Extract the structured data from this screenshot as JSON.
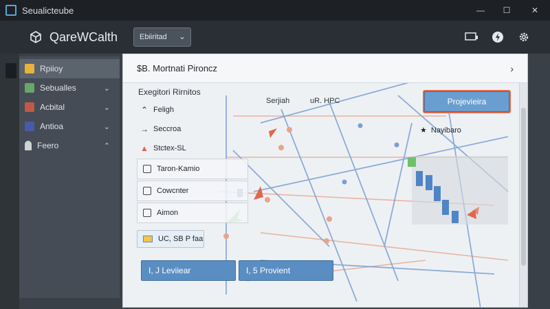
{
  "window": {
    "title": "Seualicteube",
    "min_glyph": "—",
    "max_glyph": "☐",
    "close_glyph": "✕"
  },
  "header": {
    "brand": "QarеWCalth",
    "select_value": "Ebiiritad",
    "icons": [
      "monitor-icon",
      "bolt-icon",
      "gear-icon"
    ]
  },
  "sidebar": {
    "items": [
      {
        "label": "Rpiioy",
        "icon": "folder-icon",
        "color": "#e7b33a",
        "chevron": ""
      },
      {
        "label": "Sebualles",
        "icon": "grid-icon",
        "color": "#6aa56a",
        "chevron": "⌄"
      },
      {
        "label": "Acbital",
        "icon": "layers-icon",
        "color": "#bf5a48",
        "chevron": "⌄"
      },
      {
        "label": "Antioa",
        "icon": "chart-icon",
        "color": "#4a5aa8",
        "chevron": "⌄"
      },
      {
        "label": "Feero",
        "icon": "user-icon",
        "color": "#cfd3d8",
        "chevron": "⌃"
      }
    ]
  },
  "panel": {
    "title": "$B. Mortnati Pironcz",
    "section_label": "Exegitori Rirnitos",
    "tools": [
      {
        "label": "Feligh",
        "glyph": "⌃"
      },
      {
        "label": "Seccroa",
        "glyph": "→"
      },
      {
        "label": "Stctex-SL",
        "glyph": "▲"
      }
    ],
    "tool_boxes": [
      "Taron-Kamio",
      "Cowcnter",
      "Aimon"
    ],
    "chip_label": "UC, SB P faa",
    "map_labels": {
      "label_a": "Serjiah",
      "label_b": "uR. HPC"
    },
    "legend_label": "Nayibaro",
    "primary_button": "Projevieira",
    "bottom_buttons": [
      "I, J Leviiear",
      "I, 5 Provient"
    ]
  },
  "colors": {
    "accent": "#5a8ec3",
    "primary_button_border": "#e06a4a",
    "map_line_blue": "#7b9fd4",
    "map_line_orange": "#e8a48a"
  }
}
